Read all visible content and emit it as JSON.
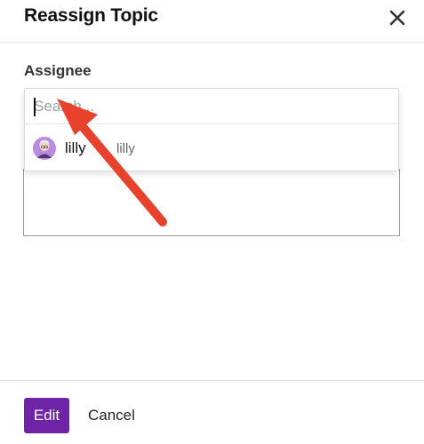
{
  "modal": {
    "title": "Reassign Topic",
    "close_icon": "close-icon"
  },
  "assignee": {
    "label": "Assignee",
    "search_placeholder": "Search...",
    "search_value": "",
    "options": [
      {
        "name": "lilly",
        "username": "lilly",
        "avatar_icon": "user-avatar"
      }
    ]
  },
  "footer": {
    "edit_label": "Edit",
    "cancel_label": "Cancel"
  },
  "colors": {
    "primary": "#6f24a8",
    "annotation_arrow": "#e8412c"
  },
  "annotation": {
    "icon": "red-arrow-annotation"
  }
}
